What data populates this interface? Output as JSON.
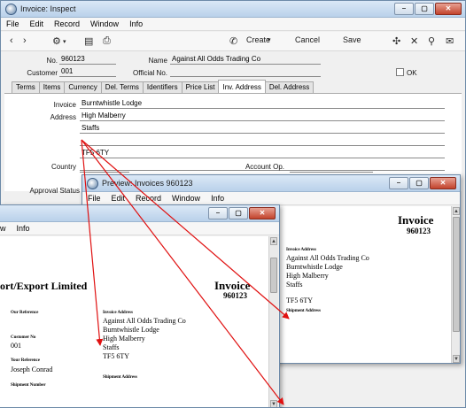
{
  "main_window": {
    "title": "Invoice: Inspect",
    "menu": [
      "File",
      "Edit",
      "Record",
      "Window",
      "Info"
    ],
    "toolbar": {
      "create_label": "Create",
      "cancel_label": "Cancel",
      "save_label": "Save"
    },
    "header": {
      "no_label": "No.",
      "no_value": "960123",
      "name_label": "Name",
      "name_value": "Against All Odds Trading Co",
      "customer_label": "Customer",
      "customer_value": "001",
      "official_label": "Official No.",
      "official_value": "",
      "ok_label": "OK"
    },
    "tabs": [
      "Terms",
      "Items",
      "Currency",
      "Del. Terms",
      "Identifiers",
      "Price List",
      "Inv. Address",
      "Del. Address"
    ],
    "active_tab": "Inv. Address",
    "address": {
      "invoice_label": "Invoice",
      "invoice_value": "Burntwhistle Lodge",
      "address_label": "Address",
      "lines": [
        "High Malberry",
        "Staffs",
        "",
        "TF5 6TY",
        ""
      ],
      "country_label": "Country",
      "country_value": "",
      "account_label": "Account Op.",
      "account_value": "",
      "approval_label": "Approval Status"
    }
  },
  "preview_front": {
    "title": "Preview: Invoices 960123",
    "menu": [
      "File",
      "Edit",
      "Record",
      "Window",
      "Info"
    ],
    "doc": {
      "heading": "Invoice",
      "number": "960123",
      "invoice_address_label": "Invoice Address",
      "address_lines": [
        "Against All Odds Trading Co",
        "Burntwhistle Lodge",
        "High Malberry",
        "Staffs",
        "TF5 6TY"
      ],
      "shipment_address_label": "Shipment Address"
    }
  },
  "preview_back": {
    "menu": [
      "w",
      "Info"
    ],
    "doc": {
      "company": "ort/Export Limited",
      "heading": "Invoice",
      "number": "960123",
      "our_reference_label": "Our Reference",
      "customer_no_label": "Customer No",
      "customer_no_value": "001",
      "your_reference_label": "Your Reference",
      "your_reference_value": "Joseph Conrad",
      "shipment_number_label": "Shipment Number",
      "invoice_address_label": "Invoice Address",
      "address_lines": [
        "Against All Odds Trading Co",
        "Burntwhistle Lodge",
        "High Malberry",
        "Staffs",
        "TF5 6TY"
      ],
      "shipment_address_label": "Shipment Address"
    }
  },
  "colors": {
    "title_gradient_top": "#dbe8f6",
    "title_gradient_bottom": "#b9d1ea",
    "close_red": "#c2432c",
    "arrow_red": "#e01010"
  }
}
